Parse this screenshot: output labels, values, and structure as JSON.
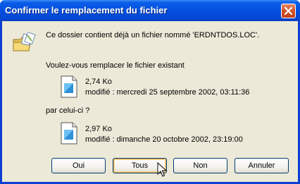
{
  "window": {
    "title": "Confirmer le remplacement du fichier"
  },
  "message": {
    "intro": "Ce dossier contient déjà un fichier nommé 'ERDNTDOS.LOC'.",
    "question": "Voulez-vous remplacer le fichier existant",
    "by_label": "par celui-ci ?"
  },
  "existing_file": {
    "size": "2,74 Ko",
    "modified": "modifié : mercredi 25 septembre 2002, 03:11:36"
  },
  "new_file": {
    "size": "2,97 Ko",
    "modified": "modifié : dimanche 20 octobre 2002, 23:19:00"
  },
  "buttons": {
    "yes": "Oui",
    "all": "Tous",
    "no": "Non",
    "cancel": "Annuler"
  }
}
